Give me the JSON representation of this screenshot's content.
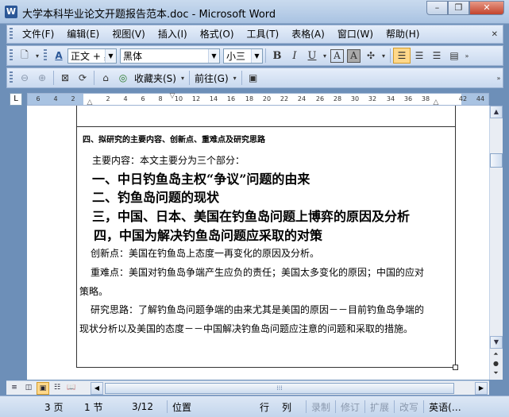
{
  "window": {
    "title": "大学本科毕业论文开题报告范本.doc - Microsoft Word",
    "app_icon_glyph": "W",
    "minimize_glyph": "–",
    "restore_glyph": "❐",
    "close_glyph": "✕"
  },
  "menu": {
    "items": [
      "文件(F)",
      "编辑(E)",
      "视图(V)",
      "插入(I)",
      "格式(O)",
      "工具(T)",
      "表格(A)",
      "窗口(W)",
      "帮助(H)"
    ],
    "close_doc_glyph": "✕"
  },
  "toolbar_format": {
    "style_value": "正文 + 黑体",
    "font_value": "黑体",
    "size_value": "小三",
    "bold": "B",
    "italic": "I",
    "underline": "U",
    "char_border": "A",
    "char_shading": "A"
  },
  "toolbar_web": {
    "favorites_label": "收藏夹(S)",
    "go_label": "前往(G)"
  },
  "ruler": {
    "corner_glyph": "L",
    "ticks": [
      "6",
      "4",
      "2",
      "2",
      "4",
      "6",
      "8",
      "10",
      "12",
      "14",
      "16",
      "18",
      "20",
      "22",
      "24",
      "26",
      "28",
      "30",
      "32",
      "34",
      "36",
      "38",
      "42",
      "44"
    ]
  },
  "document": {
    "section_heading": "四、拟研究的主要内容、创新点、重难点及研究思路",
    "intro": "主要内容：本文主要分为三个部分：",
    "points": [
      "一、中日钓鱼岛主权“争议”问题的由来",
      "二、钓鱼岛问题的现状",
      "三，中国、日本、美国在钓鱼岛问题上博弈的原因及分析",
      "四，中国为解决钓鱼岛问题应采取的对策"
    ],
    "innovation": "创新点：美国在钓鱼岛上态度一再变化的原因及分析。",
    "difficulty_line1": "重难点：美国对钓鱼岛争端产生应负的责任；美国太多变化的原因；中国的应对",
    "difficulty_line2": "策略。",
    "approach_line1": "研究思路：了解钓鱼岛问题争端的由来尤其是美国的原因－－目前钓鱼岛争端的",
    "approach_line2": "现状分析以及美国的态度－－中国解决钓鱼岛问题应注意的问题和采取的措施。"
  },
  "statusbar": {
    "page": "3 页",
    "section": "1 节",
    "page_of": "3/12",
    "position": "位置",
    "line": "行",
    "column": "列",
    "record": "录制",
    "revise": "修订",
    "extend": "扩展",
    "overtype": "改写",
    "language": "英语(…"
  }
}
